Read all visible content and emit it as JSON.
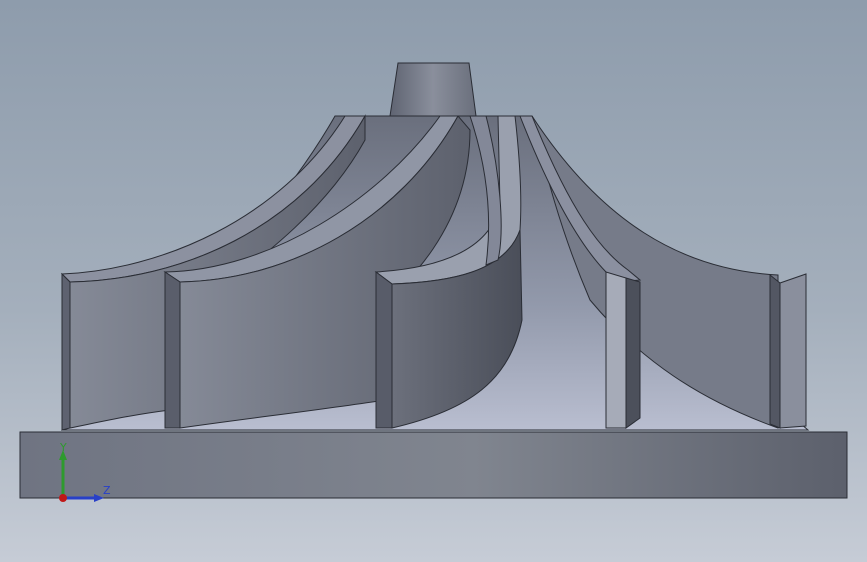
{
  "viewport": {
    "background_top": "#8e9cac",
    "background_bottom": "#c6ccd6",
    "model_color": "#7a7f8d"
  },
  "triad": {
    "y_label": "Y",
    "z_label": "Z",
    "y_color": "#2e9a2e",
    "z_color": "#2840c8",
    "origin_color": "#c01818"
  }
}
